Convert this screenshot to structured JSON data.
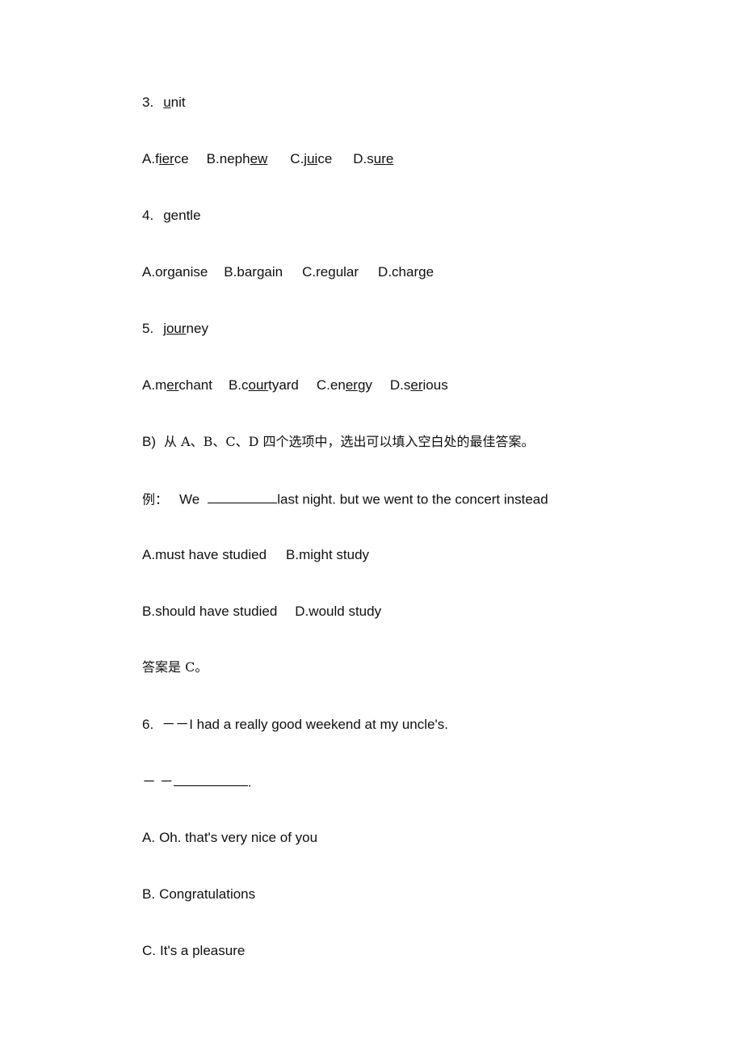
{
  "document": {
    "type": "english-exam-paper",
    "background_color": "#ffffff",
    "text_color": "#101010"
  },
  "questions": [
    {
      "number": "3.",
      "stem_pre": "",
      "stem_word_pre": "",
      "stem_word_underline": "u",
      "stem_word_post": "nit",
      "stem_full": "unit",
      "options": [
        {
          "label": "A.",
          "pre": "f",
          "underline": "ier",
          "post": "ce",
          "full": "fierce"
        },
        {
          "label": "B.",
          "pre": "neph",
          "underline": "ew",
          "post": "",
          "full": "nephew"
        },
        {
          "label": "C.",
          "pre": "j",
          "underline": "ui",
          "post": "ce",
          "full": "juice"
        },
        {
          "label": "D.",
          "pre": "s",
          "underline": "ure",
          "post": "",
          "full": "sure"
        }
      ]
    },
    {
      "number": "4.",
      "stem_word_pre": "",
      "stem_word_underline": "g",
      "stem_word_post": "entle",
      "stem_full": "gentle",
      "options": [
        {
          "label": "A.",
          "pre": "or",
          "underline": "g",
          "post": "anise",
          "full": "organise"
        },
        {
          "label": "B.",
          "pre": "bar",
          "underline": "g",
          "post": "ain",
          "full": "bargain"
        },
        {
          "label": "C.",
          "pre": "re",
          "underline": "g",
          "post": "ular",
          "full": "regular"
        },
        {
          "label": "D.",
          "pre": "char",
          "underline": "g",
          "post": "e",
          "full": "charge"
        }
      ]
    },
    {
      "number": "5.",
      "stem_word_pre": "j",
      "stem_word_underline": "our",
      "stem_word_post": "ney",
      "stem_full": "journey",
      "options": [
        {
          "label": "A.",
          "pre": "m",
          "underline": "er",
          "post": "chant",
          "full": "merchant"
        },
        {
          "label": "B.",
          "pre": "c",
          "underline": "our",
          "post": "tyard",
          "full": "courtyard"
        },
        {
          "label": "C.",
          "pre": "en",
          "underline": "er",
          "post": "gy",
          "full": "energy"
        },
        {
          "label": "D.",
          "pre": "s",
          "underline": "er",
          "post": "ious",
          "full": "serious"
        }
      ]
    }
  ],
  "section_b": {
    "marker": "B)",
    "instruction": "从 A、B、C、D 四个选项中，选出可以填入空白处的最佳答案。",
    "example": {
      "label": "例：",
      "sentence_before_blank": "We",
      "sentence_after_blank": "last night. but we went to the concert instead",
      "options_row1": [
        {
          "label": "A.",
          "text": "must have studied"
        },
        {
          "label": "B.",
          "text": "might study"
        }
      ],
      "options_row2": [
        {
          "label": "B.",
          "text": "should have studied"
        },
        {
          "label": "D.",
          "text": "would study"
        }
      ],
      "answer_line": "答案是 C。"
    }
  },
  "question_6": {
    "number": "6.",
    "dash_marker": "－－",
    "speaker_a": "I had a really good weekend at my uncle's.",
    "reply_dash": "－ －",
    "reply_after_blank": ".",
    "options": [
      {
        "label": "A.",
        "text": "Oh. that's very nice of you"
      },
      {
        "label": "B.",
        "text": "Congratulations"
      },
      {
        "label": "C.",
        "text": "It's a pleasure"
      }
    ]
  }
}
